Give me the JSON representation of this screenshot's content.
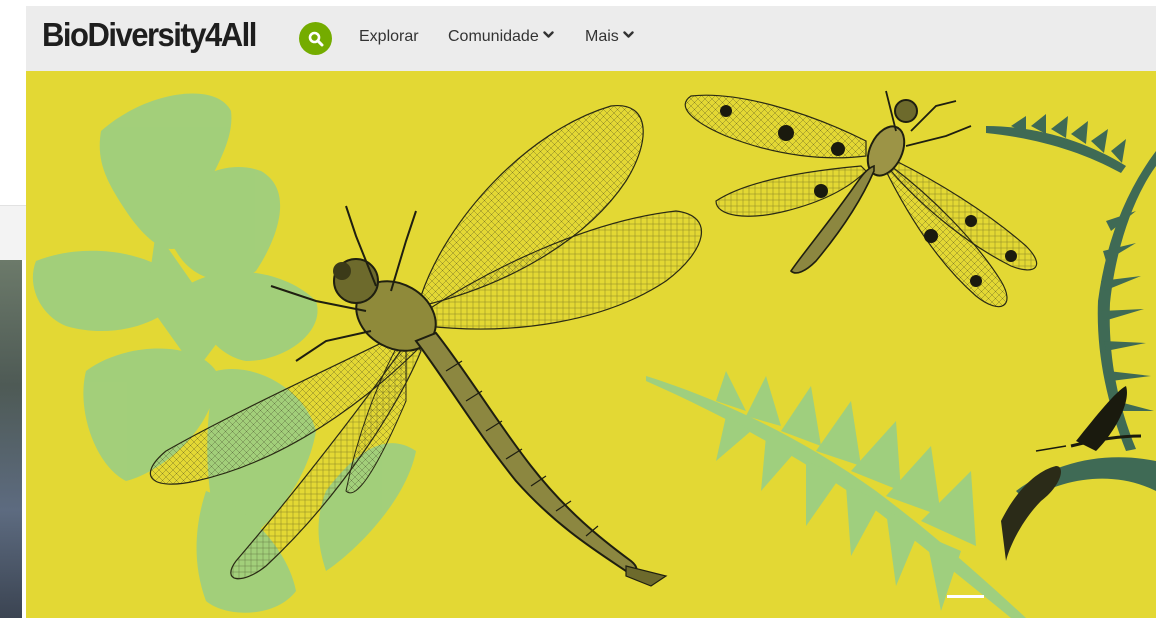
{
  "brand": {
    "logo_text": "BioDiversity4All",
    "accent_color": "#74ac00",
    "hero_color": "#e3d834"
  },
  "nav": {
    "search_icon": "search-icon",
    "items": [
      {
        "label": "Explorar",
        "has_dropdown": false
      },
      {
        "label": "Comunidade",
        "has_dropdown": true
      },
      {
        "label": "Mais",
        "has_dropdown": true
      }
    ]
  },
  "hero": {
    "slides_visible": 1,
    "active_slide": 1
  }
}
